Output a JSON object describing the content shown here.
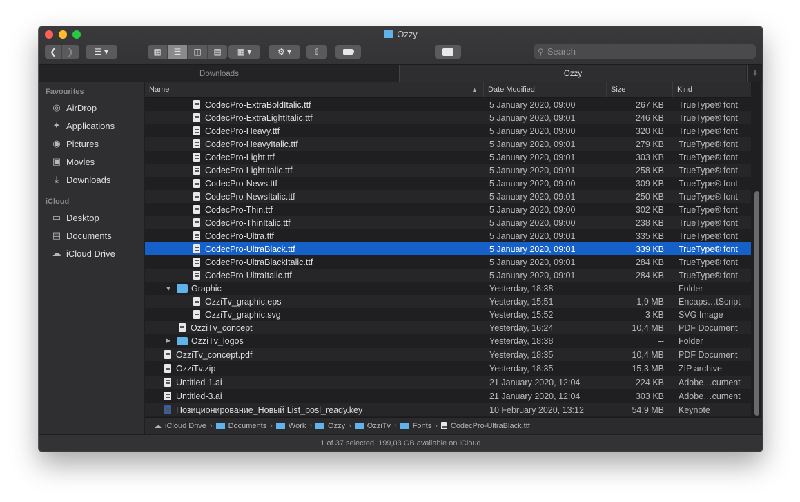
{
  "window": {
    "title": "Ozzy",
    "traffic_lights": {
      "close": "#fe5f57",
      "minimize": "#febc2e",
      "zoom": "#28c840"
    }
  },
  "toolbar": {
    "back_icon": "chevron-left-icon",
    "forward_icon": "chevron-right-icon",
    "search_placeholder": "Search"
  },
  "tabs": [
    {
      "label": "Downloads",
      "active": false
    },
    {
      "label": "Ozzy",
      "active": true
    }
  ],
  "sidebar": {
    "favourites_label": "Favourites",
    "favourites": [
      {
        "label": "AirDrop",
        "icon": "airdrop-icon"
      },
      {
        "label": "Applications",
        "icon": "applications-icon"
      },
      {
        "label": "Pictures",
        "icon": "camera-icon"
      },
      {
        "label": "Movies",
        "icon": "film-icon"
      },
      {
        "label": "Downloads",
        "icon": "download-icon"
      }
    ],
    "icloud_label": "iCloud",
    "icloud": [
      {
        "label": "Desktop",
        "icon": "desktop-icon"
      },
      {
        "label": "Documents",
        "icon": "documents-icon"
      },
      {
        "label": "iCloud Drive",
        "icon": "cloud-icon"
      }
    ]
  },
  "columns": {
    "name": "Name",
    "date": "Date Modified",
    "size": "Size",
    "kind": "Kind"
  },
  "files": [
    {
      "name": "CodecPro-ExtraBoldItalic.ttf",
      "date": "5 January 2020, 09:00",
      "size": "267 KB",
      "kind": "TrueType® font",
      "type": "doc",
      "indent": 2
    },
    {
      "name": "CodecPro-ExtraLightItalic.ttf",
      "date": "5 January 2020, 09:01",
      "size": "246 KB",
      "kind": "TrueType® font",
      "type": "doc",
      "indent": 2
    },
    {
      "name": "CodecPro-Heavy.ttf",
      "date": "5 January 2020, 09:00",
      "size": "320 KB",
      "kind": "TrueType® font",
      "type": "doc",
      "indent": 2
    },
    {
      "name": "CodecPro-HeavyItalic.ttf",
      "date": "5 January 2020, 09:01",
      "size": "279 KB",
      "kind": "TrueType® font",
      "type": "doc",
      "indent": 2
    },
    {
      "name": "CodecPro-Light.ttf",
      "date": "5 January 2020, 09:01",
      "size": "303 KB",
      "kind": "TrueType® font",
      "type": "doc",
      "indent": 2
    },
    {
      "name": "CodecPro-LightItalic.ttf",
      "date": "5 January 2020, 09:01",
      "size": "258 KB",
      "kind": "TrueType® font",
      "type": "doc",
      "indent": 2
    },
    {
      "name": "CodecPro-News.ttf",
      "date": "5 January 2020, 09:00",
      "size": "309 KB",
      "kind": "TrueType® font",
      "type": "doc",
      "indent": 2
    },
    {
      "name": "CodecPro-NewsItalic.ttf",
      "date": "5 January 2020, 09:01",
      "size": "250 KB",
      "kind": "TrueType® font",
      "type": "doc",
      "indent": 2
    },
    {
      "name": "CodecPro-Thin.ttf",
      "date": "5 January 2020, 09:00",
      "size": "302 KB",
      "kind": "TrueType® font",
      "type": "doc",
      "indent": 2
    },
    {
      "name": "CodecPro-ThinItalic.ttf",
      "date": "5 January 2020, 09:00",
      "size": "238 KB",
      "kind": "TrueType® font",
      "type": "doc",
      "indent": 2
    },
    {
      "name": "CodecPro-Ultra.ttf",
      "date": "5 January 2020, 09:01",
      "size": "335 KB",
      "kind": "TrueType® font",
      "type": "doc",
      "indent": 2
    },
    {
      "name": "CodecPro-UltraBlack.ttf",
      "date": "5 January 2020, 09:01",
      "size": "339 KB",
      "kind": "TrueType® font",
      "type": "doc",
      "indent": 2,
      "selected": true
    },
    {
      "name": "CodecPro-UltraBlackItalic.ttf",
      "date": "5 January 2020, 09:01",
      "size": "284 KB",
      "kind": "TrueType® font",
      "type": "doc",
      "indent": 2
    },
    {
      "name": "CodecPro-UltraItalic.ttf",
      "date": "5 January 2020, 09:01",
      "size": "284 KB",
      "kind": "TrueType® font",
      "type": "doc",
      "indent": 2
    },
    {
      "name": "Graphic",
      "date": "Yesterday, 18:38",
      "size": "--",
      "kind": "Folder",
      "type": "folder",
      "indent": 1,
      "expanded": true
    },
    {
      "name": "OzziTv_graphic.eps",
      "date": "Yesterday, 15:51",
      "size": "1,9 MB",
      "kind": "Encaps…tScript",
      "type": "doc",
      "indent": 2
    },
    {
      "name": "OzziTv_graphic.svg",
      "date": "Yesterday, 15:52",
      "size": "3 KB",
      "kind": "SVG Image",
      "type": "doc",
      "indent": 2
    },
    {
      "name": "OzziTv_concept",
      "date": "Yesterday, 16:24",
      "size": "10,4 MB",
      "kind": "PDF Document",
      "type": "doc",
      "indent": 1
    },
    {
      "name": "OzziTv_logos",
      "date": "Yesterday, 18:38",
      "size": "--",
      "kind": "Folder",
      "type": "folder",
      "indent": 1,
      "expanded": false
    },
    {
      "name": "OzziTv_concept.pdf",
      "date": "Yesterday, 18:35",
      "size": "10,4 MB",
      "kind": "PDF Document",
      "type": "doc",
      "indent": 0
    },
    {
      "name": "OzziTv.zip",
      "date": "Yesterday, 18:35",
      "size": "15,3 MB",
      "kind": "ZIP archive",
      "type": "doc",
      "indent": 0
    },
    {
      "name": "Untitled-1.ai",
      "date": "21 January 2020, 12:04",
      "size": "224 KB",
      "kind": "Adobe…cument",
      "type": "doc",
      "indent": 0
    },
    {
      "name": "Untitled-3.ai",
      "date": "21 January 2020, 12:04",
      "size": "303 KB",
      "kind": "Adobe…cument",
      "type": "doc",
      "indent": 0
    },
    {
      "name": "Позиционирование_Новый List_posl_ready.key",
      "date": "10 February 2020, 13:12",
      "size": "54,9 MB",
      "kind": "Keynote",
      "type": "key",
      "indent": 0
    }
  ],
  "path_bar": [
    "iCloud Drive",
    "Documents",
    "Work",
    "Ozzy",
    "OzziTv",
    "Fonts",
    "CodecPro-UltraBlack.ttf"
  ],
  "status": "1 of 37 selected, 199,03 GB available on iCloud"
}
